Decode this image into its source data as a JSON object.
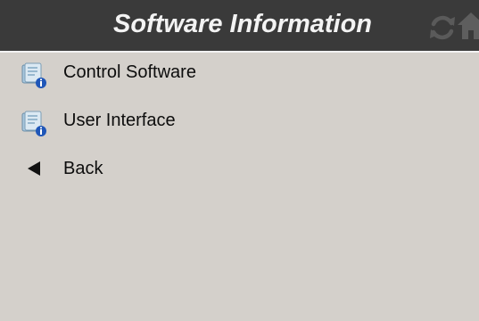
{
  "header": {
    "title": "Software Information",
    "icons": {
      "refresh": "refresh-icon",
      "home": "home-icon"
    },
    "background": "#3a3a3a",
    "title_color": "#f3f3f3"
  },
  "menu": {
    "items": [
      {
        "label": "Control Software",
        "icon": "software-info-icon"
      },
      {
        "label": "User Interface",
        "icon": "software-info-icon"
      },
      {
        "label": "Back",
        "icon": "back-arrow-icon"
      }
    ]
  },
  "colors": {
    "page_background": "#d4d0cb",
    "text": "#0d0d0d"
  }
}
